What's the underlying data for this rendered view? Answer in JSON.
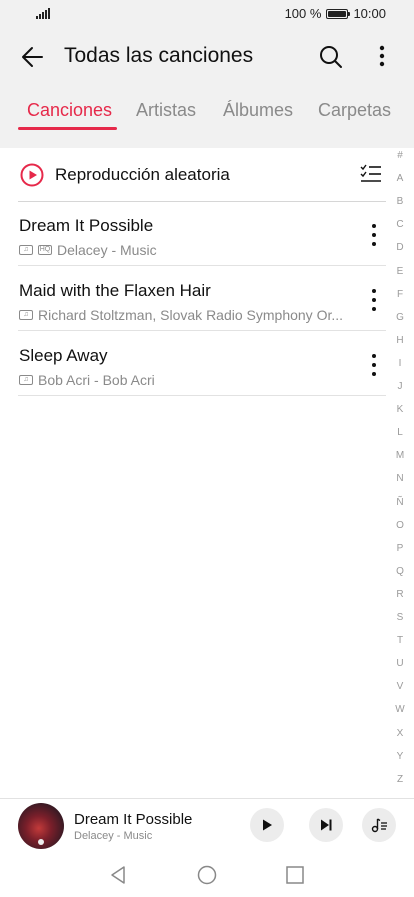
{
  "status_bar": {
    "battery_text": "100 %",
    "time": "10:00"
  },
  "header": {
    "title": "Todas las canciones"
  },
  "tabs": [
    {
      "label": "Canciones",
      "active": true
    },
    {
      "label": "Artistas",
      "active": false
    },
    {
      "label": "Álbumes",
      "active": false
    },
    {
      "label": "Carpetas",
      "active": false
    }
  ],
  "shuffle": {
    "label": "Reproducción aleatoria"
  },
  "songs": [
    {
      "title": "Dream It Possible",
      "tags": [
        "♫",
        "HQ"
      ],
      "subtitle": "Delacey - Music"
    },
    {
      "title": "Maid with the Flaxen Hair",
      "tags": [
        "♫"
      ],
      "subtitle": "Richard Stoltzman, Slovak Radio Symphony Or..."
    },
    {
      "title": "Sleep Away",
      "tags": [
        "♫"
      ],
      "subtitle": "Bob Acri - Bob Acri"
    }
  ],
  "index": [
    "#",
    "A",
    "B",
    "C",
    "D",
    "E",
    "F",
    "G",
    "H",
    "I",
    "J",
    "K",
    "L",
    "M",
    "N",
    "Ñ",
    "O",
    "P",
    "Q",
    "R",
    "S",
    "T",
    "U",
    "V",
    "W",
    "X",
    "Y",
    "Z"
  ],
  "player": {
    "title": "Dream It Possible",
    "artist": "Delacey - Music"
  },
  "colors": {
    "accent": "#e6294a",
    "text": "#111111",
    "secondary": "#8a8a8a",
    "background": "#f1f1f1",
    "card": "#ffffff"
  }
}
